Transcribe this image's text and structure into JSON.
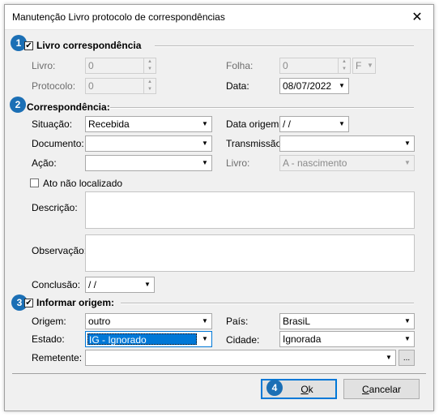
{
  "window": {
    "title": "Manutenção Livro protocolo de correspondências",
    "close_glyph": "✕"
  },
  "badges": [
    "1",
    "2",
    "3",
    "4"
  ],
  "livro_section": {
    "title": "Livro correspondência",
    "checked": true,
    "livro_label": "Livro:",
    "livro_value": "0",
    "folha_label": "Folha:",
    "folha_value": "0",
    "folha_side": "F",
    "protocolo_label": "Protocolo:",
    "protocolo_value": "0",
    "data_label": "Data:",
    "data_value": "08/07/2022"
  },
  "correspondencia": {
    "title": "Correspondência:",
    "situacao_label": "Situação:",
    "situacao_value": "Recebida",
    "data_origem_label": "Data origem:",
    "data_origem_value": " /  /",
    "documento_label": "Documento:",
    "documento_value": "",
    "transmissao_label": "Transmissão:",
    "transmissao_value": "",
    "acao_label": "Ação:",
    "acao_value": "",
    "livro_label": "Livro:",
    "livro_value": "A - nascimento",
    "ato_label": "Ato não localizado",
    "descricao_label": "Descrição:",
    "observacao_label": "Observação:",
    "conclusao_label": "Conclusão:",
    "conclusao_value": " /  /"
  },
  "origem": {
    "title": "Informar origem:",
    "checked": true,
    "origem_label": "Origem:",
    "origem_value": "outro",
    "pais_label": "País:",
    "pais_value": "BrasiL",
    "estado_label": "Estado:",
    "estado_value": "IG - Ignorado",
    "cidade_label": "Cidade:",
    "cidade_value": "Ignorada",
    "remetente_label": "Remetente:",
    "remetente_value": "",
    "ellipsis": "..."
  },
  "buttons": {
    "ok_mnemonic": "O",
    "ok_rest": "k",
    "cancel_mnemonic": "C",
    "cancel_rest": "ancelar"
  },
  "colors": {
    "badge": "#1b6fb5",
    "selection": "#0078d7",
    "dialog_bg": "#f0f0f0"
  }
}
